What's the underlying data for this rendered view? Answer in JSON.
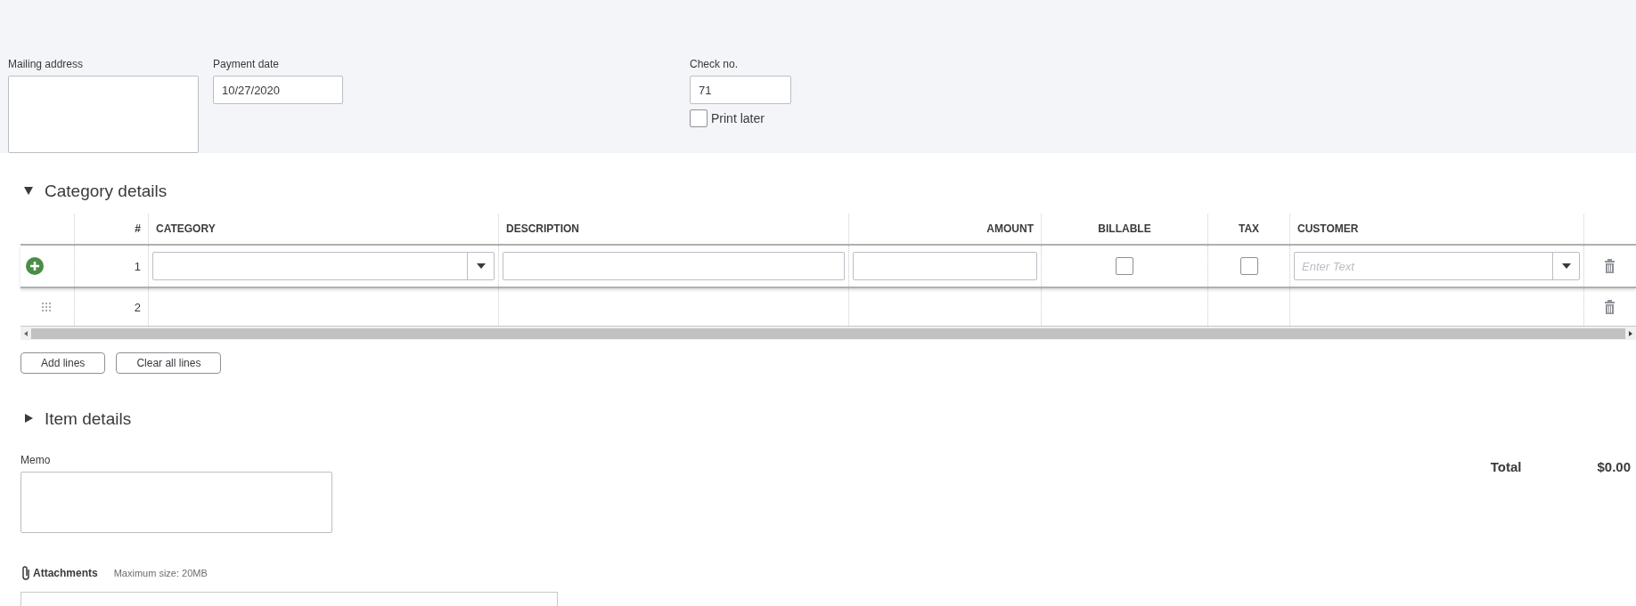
{
  "header": {
    "mailing_address": {
      "label": "Mailing address"
    },
    "payment_date": {
      "label": "Payment date",
      "value": "10/27/2020"
    },
    "check_no": {
      "label": "Check no.",
      "value": "71"
    },
    "print_later": {
      "label": "Print later",
      "checked": false
    }
  },
  "category_details": {
    "title": "Category details",
    "expanded": true,
    "columns": [
      {},
      {
        "label": "#"
      },
      {
        "label": "CATEGORY"
      },
      {
        "label": "DESCRIPTION"
      },
      {
        "label": "AMOUNT"
      },
      {
        "label": "BILLABLE"
      },
      {
        "label": "TAX"
      },
      {
        "label": "CUSTOMER"
      },
      {}
    ],
    "rows": [
      {
        "kind": "edit",
        "number": "1",
        "billable": false,
        "tax": false,
        "customer_placeholder": "Enter Text"
      },
      {
        "kind": "plain",
        "number": "2"
      }
    ],
    "buttons": [
      "Add lines",
      "Clear all lines"
    ]
  },
  "item_details": {
    "title": "Item details",
    "expanded": false
  },
  "memo": {
    "label": "Memo"
  },
  "total": {
    "label": "Total",
    "value": "$0.00"
  },
  "attachments": {
    "label": "Attachments",
    "note": "Maximum size: 20MB"
  }
}
